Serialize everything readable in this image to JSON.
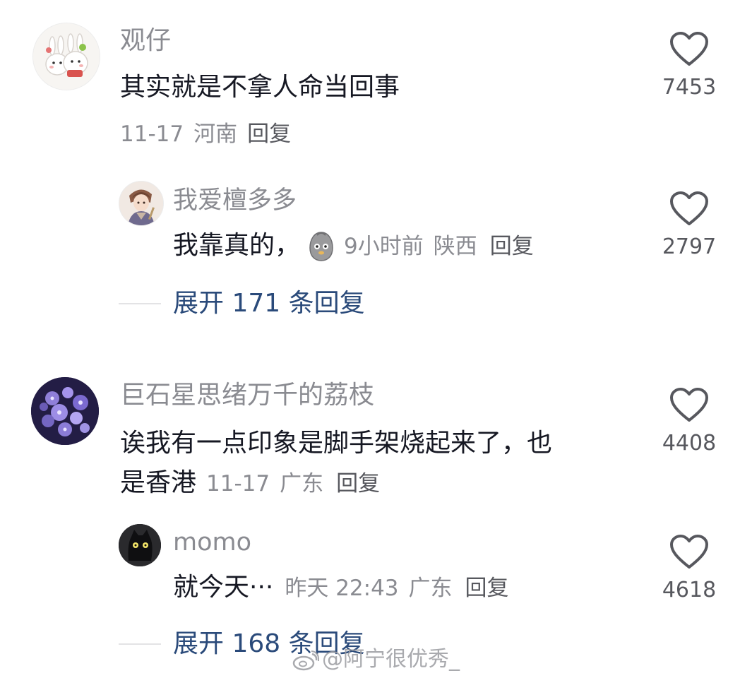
{
  "comments": [
    {
      "username": "观仔",
      "text": "其实就是不拿人命当回事",
      "date": "11-17",
      "location": "河南",
      "reply_label": "回复",
      "likes": "7453",
      "avatar_icon": "bunny-couple-avatar",
      "replies": [
        {
          "username": "我爱檀多多",
          "text": "我靠真的，",
          "sticker_icon": "grey-blob-sticker",
          "time": "9小时前",
          "location": "陕西",
          "reply_label": "回复",
          "likes": "2797",
          "avatar_icon": "anime-character-avatar"
        }
      ],
      "expand_label": "展开 171 条回复"
    },
    {
      "username": "巨石星思绪万千的荔枝",
      "text_line1": "诶我有一点印象是脚手架烧起来了，也",
      "text_line2": "是香港",
      "date": "11-17",
      "location": "广东",
      "reply_label": "回复",
      "likes": "4408",
      "avatar_icon": "purple-flowers-avatar",
      "replies": [
        {
          "username": "momo",
          "text": "就今天···",
          "time": "昨天 22:43",
          "location": "广东",
          "reply_label": "回复",
          "likes": "4618",
          "avatar_icon": "black-cat-avatar"
        }
      ],
      "expand_label": "展开 168 条回复"
    }
  ],
  "watermark": "@阿宁很优秀_",
  "colors": {
    "text_primary": "#161823",
    "text_secondary": "#8a8b91",
    "expand_link": "#2a4a7a",
    "heart_outline": "#57585e"
  }
}
